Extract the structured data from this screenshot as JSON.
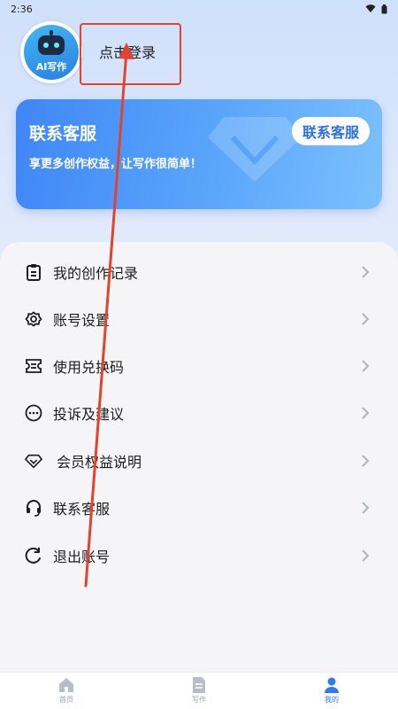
{
  "status_bar": {
    "time": "2:36",
    "icons": [
      "wifi-icon",
      "battery-icon"
    ]
  },
  "profile": {
    "avatar_label": "AI写作",
    "login_text": "点击登录"
  },
  "banner": {
    "title": "联系客服",
    "subtitle": "享更多创作权益，让写作很简单！",
    "button_label": "联系客服"
  },
  "menu": {
    "items": [
      {
        "label": "我的创作记录",
        "icon": "clipboard-icon"
      },
      {
        "label": "账号设置",
        "icon": "settings-icon"
      },
      {
        "label": "使用兑换码",
        "icon": "ticket-icon"
      },
      {
        "label": "投诉及建议",
        "icon": "chat-dots-icon"
      },
      {
        "label": "会员权益说明",
        "icon": "diamond-icon"
      },
      {
        "label": "联系客服",
        "icon": "headset-icon"
      },
      {
        "label": "退出账号",
        "icon": "logout-icon"
      }
    ]
  },
  "bottom_nav": {
    "items": [
      {
        "label": "首页",
        "icon": "home-icon",
        "active": false
      },
      {
        "label": "写作",
        "icon": "document-icon",
        "active": false
      },
      {
        "label": "我的",
        "icon": "user-icon",
        "active": true
      }
    ]
  },
  "colors": {
    "accent": "#2f7cf2",
    "annotation": "#e0432e"
  }
}
